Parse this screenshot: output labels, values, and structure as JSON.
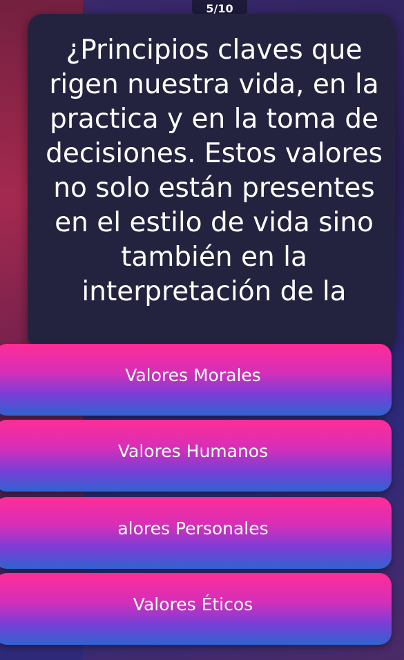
{
  "progress": {
    "counter": "5/10"
  },
  "question": {
    "text": "¿Principios claves que rigen nuestra vida, en la practica y en la toma de decisiones. Estos valores no solo están presentes en el estilo de vida sino también en la interpretación de la"
  },
  "options": [
    {
      "label": "Valores Morales"
    },
    {
      "label": "Valores Humanos"
    },
    {
      "label": "alores Personales"
    },
    {
      "label": "Valores Éticos"
    }
  ],
  "colors": {
    "card_bg": "#24233f",
    "option_top": "#ff2d96",
    "option_bottom": "#2f63cf",
    "text": "#ffffff"
  }
}
